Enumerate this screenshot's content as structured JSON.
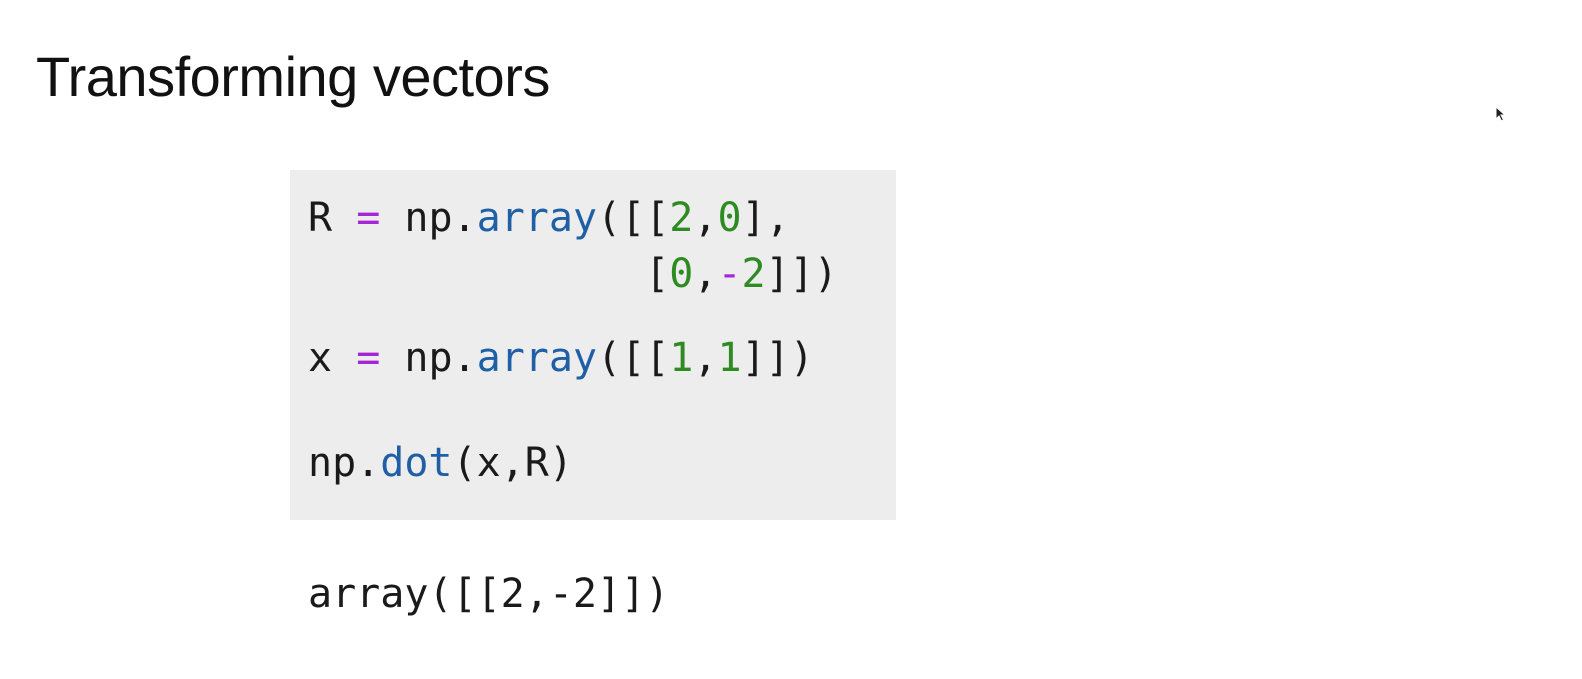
{
  "slide": {
    "title": "Transforming vectors"
  },
  "code_cell": {
    "line1": {
      "var": "R",
      "eq": "=",
      "mod": "np.",
      "fn": "array",
      "open": "([[",
      "a": "2",
      "comma1": ",",
      "b": "0",
      "close": "],"
    },
    "line2": {
      "open": "[",
      "a": "0",
      "comma": ",",
      "minus": "-",
      "b": "2",
      "close": "]])"
    },
    "line3": {
      "var": "x",
      "eq": "=",
      "mod": "np.",
      "fn": "array",
      "open": "([[",
      "a": "1",
      "comma": ",",
      "b": "1",
      "close": "]])"
    },
    "line4": {
      "mod": "np.",
      "fn": "dot",
      "args": "(x,R)"
    }
  },
  "output": {
    "text": "array([[2,-2]])"
  },
  "colors": {
    "operator": "#a626d6",
    "function": "#1f5fa6",
    "number": "#2e8b22",
    "code_background": "#ededed"
  },
  "icons": {
    "cursor": "mouse-pointer-icon"
  }
}
